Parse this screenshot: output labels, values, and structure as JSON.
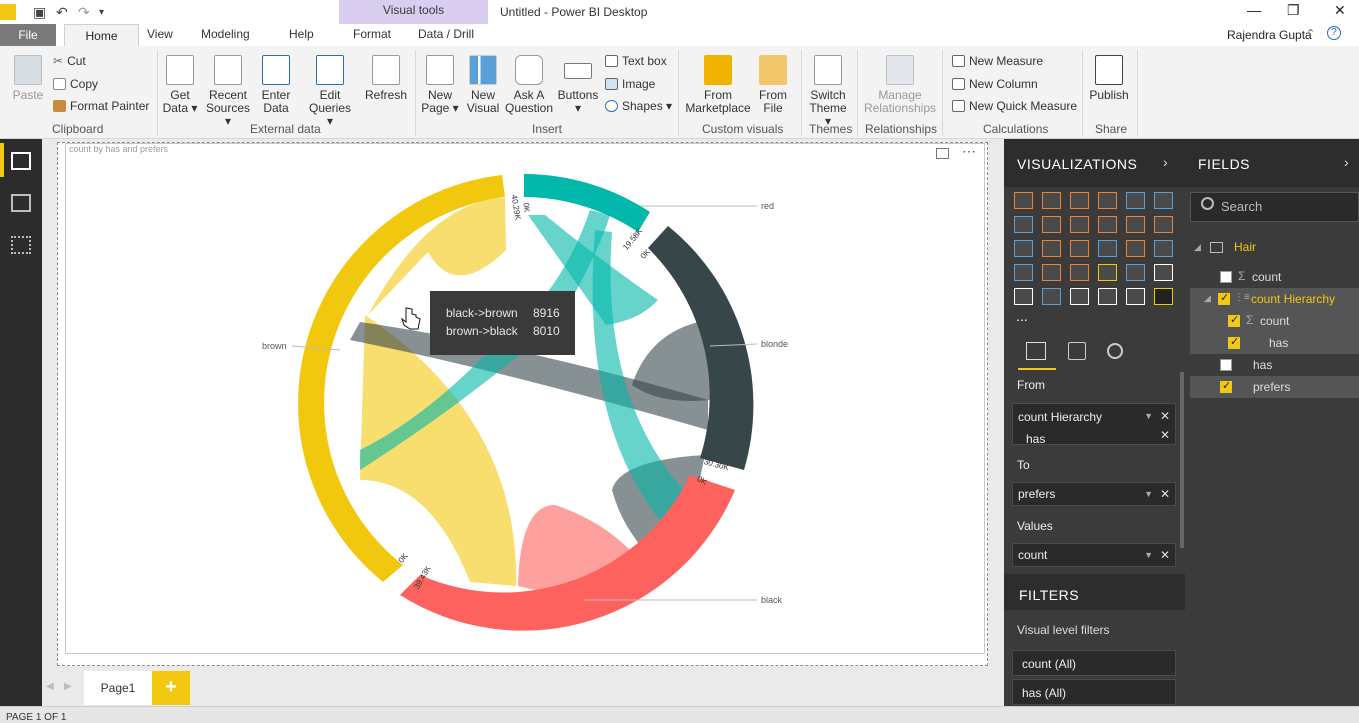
{
  "window": {
    "app_title": "Untitled - Power BI Desktop",
    "contextual_group": "Visual tools",
    "user": "Rajendra Gupta"
  },
  "tabs": {
    "file": "File",
    "home": "Home",
    "view": "View",
    "modeling": "Modeling",
    "help": "Help",
    "format": "Format",
    "data_drill": "Data / Drill"
  },
  "ribbon": {
    "clipboard": {
      "paste": "Paste",
      "cut": "Cut",
      "copy": "Copy",
      "format_painter": "Format Painter",
      "group": "Clipboard"
    },
    "external_data": {
      "get_data": "Get Data ▾",
      "recent_sources": "Recent Sources ▾",
      "enter_data": "Enter Data",
      "edit_queries": "Edit Queries ▾",
      "refresh": "Refresh",
      "group": "External data"
    },
    "insert": {
      "new_page": "New Page ▾",
      "new_visual": "New Visual",
      "ask_a_question": "Ask A Question",
      "buttons": "Buttons ▾",
      "text_box": "Text box",
      "image": "Image",
      "shapes": "Shapes ▾",
      "group": "Insert"
    },
    "custom_visuals": {
      "from_marketplace": "From Marketplace",
      "from_file": "From File",
      "group": "Custom visuals"
    },
    "themes": {
      "switch_theme": "Switch Theme ▾",
      "group": "Themes"
    },
    "relationships": {
      "manage": "Manage Relationships",
      "group": "Relationships"
    },
    "calculations": {
      "new_measure": "New Measure",
      "new_column": "New Column",
      "new_quick_measure": "New Quick Measure",
      "group": "Calculations"
    },
    "share": {
      "publish": "Publish",
      "group": "Share"
    }
  },
  "visual": {
    "title": "count by has and prefers",
    "tooltip": [
      {
        "label": "black->brown",
        "value": "8916"
      },
      {
        "label": "brown->black",
        "value": "8010"
      }
    ]
  },
  "chart_data": {
    "type": "chord",
    "nodes": [
      "red",
      "blonde",
      "black",
      "brown"
    ],
    "node_colors": {
      "red": "#01b8aa",
      "blonde": "#374649",
      "black": "#fd625e",
      "brown": "#f2c80f"
    },
    "flows": [
      {
        "from": "black",
        "to": "brown",
        "value": 8916
      },
      {
        "from": "brown",
        "to": "black",
        "value": 8010
      }
    ],
    "tick_labels": [
      "40.29K",
      "0K",
      "19.58K",
      "0K",
      "30.30K",
      "0K",
      "0K",
      "39.43K"
    ]
  },
  "pages": {
    "page1": "Page1",
    "add": "+",
    "status": "PAGE 1 OF 1"
  },
  "visualizations_pane": {
    "title": "VISUALIZATIONS",
    "wells": {
      "from_label": "From",
      "from_field": "count Hierarchy",
      "from_sub": "has",
      "to_label": "To",
      "to_field": "prefers",
      "values_label": "Values",
      "values_field": "count"
    },
    "more": "..."
  },
  "filters_pane": {
    "title": "FILTERS",
    "visual_level": "Visual level filters",
    "items": [
      "count (All)",
      "has (All)"
    ]
  },
  "fields_pane": {
    "title": "FIELDS",
    "search_placeholder": "Search",
    "table": "Hair",
    "fields": {
      "count": "count",
      "count_hierarchy": "count Hierarchy",
      "hier_count": "count",
      "hier_has": "has",
      "has": "has",
      "prefers": "prefers"
    }
  }
}
